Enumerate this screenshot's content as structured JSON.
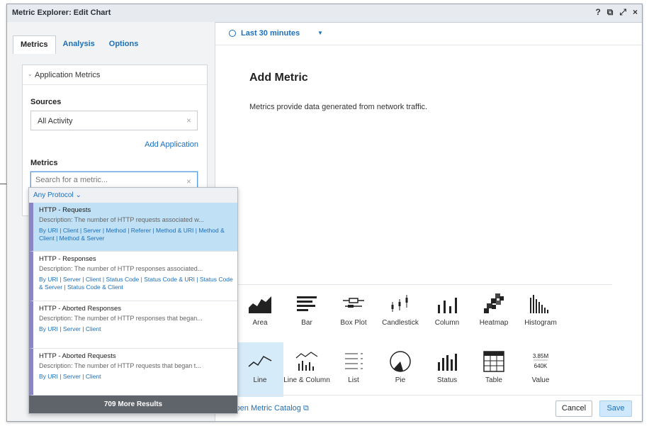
{
  "window": {
    "title": "Metric Explorer: Edit Chart",
    "controls": [
      "?",
      "⧉",
      "⤢",
      "×"
    ]
  },
  "tabs": [
    "Metrics",
    "Analysis",
    "Options"
  ],
  "metrics_panel": {
    "section_title": "Application Metrics",
    "sources_label": "Sources",
    "sources_value": "All Activity",
    "add_application": "Add Application",
    "metrics_label": "Metrics",
    "search_placeholder": "Search for a metric..."
  },
  "dropdown": {
    "filter": "Any Protocol ⌄",
    "results": [
      {
        "title": "HTTP - Requests",
        "description": "Description: The number of HTTP requests associated w...",
        "links": "By URI | Client | Server | Method | Referer | Method & URI | Method & Client | Method & Server"
      },
      {
        "title": "HTTP - Responses",
        "description": "Description: The number of HTTP responses associated...",
        "links": "By URI | Server | Client | Status Code | Status Code & URI | Status Code & Server | Status Code & Client"
      },
      {
        "title": "HTTP - Aborted Responses",
        "description": "Description: The number of HTTP responses that began...",
        "links": "By URI | Server | Client"
      },
      {
        "title": "HTTP - Aborted Requests",
        "description": "Description: The number of HTTP requests that began t...",
        "links": "By URI | Server | Client"
      }
    ],
    "more_results": "709 More Results"
  },
  "main": {
    "time_range": "Last 30 minutes",
    "heading": "Add Metric",
    "description": "Metrics provide data generated from network traffic."
  },
  "chart_types": [
    {
      "label": "Area",
      "icon": "area-chart-icon"
    },
    {
      "label": "Bar",
      "icon": "bar-chart-icon"
    },
    {
      "label": "Box Plot",
      "icon": "box-plot-icon"
    },
    {
      "label": "Candlestick",
      "icon": "candlestick-icon"
    },
    {
      "label": "Column",
      "icon": "column-chart-icon"
    },
    {
      "label": "Heatmap",
      "icon": "heatmap-icon"
    },
    {
      "label": "Histogram",
      "icon": "histogram-icon"
    },
    {
      "label": "Line",
      "icon": "line-chart-icon",
      "selected": true
    },
    {
      "label": "Line & Column",
      "icon": "line-column-icon"
    },
    {
      "label": "List",
      "icon": "list-icon"
    },
    {
      "label": "Pie",
      "icon": "pie-chart-icon"
    },
    {
      "label": "Status",
      "icon": "status-icon"
    },
    {
      "label": "Table",
      "icon": "table-icon"
    },
    {
      "label": "Value",
      "icon": "value-icon",
      "icon_values": [
        "3.85M",
        "640K"
      ]
    }
  ],
  "footer": {
    "catalog_link": "Open Metric Catalog",
    "cancel": "Cancel",
    "save": "Save"
  },
  "colors": {
    "accent": "#1c6fba",
    "selection": "#bfe0f5",
    "result_stripe": "#8a86c4"
  }
}
